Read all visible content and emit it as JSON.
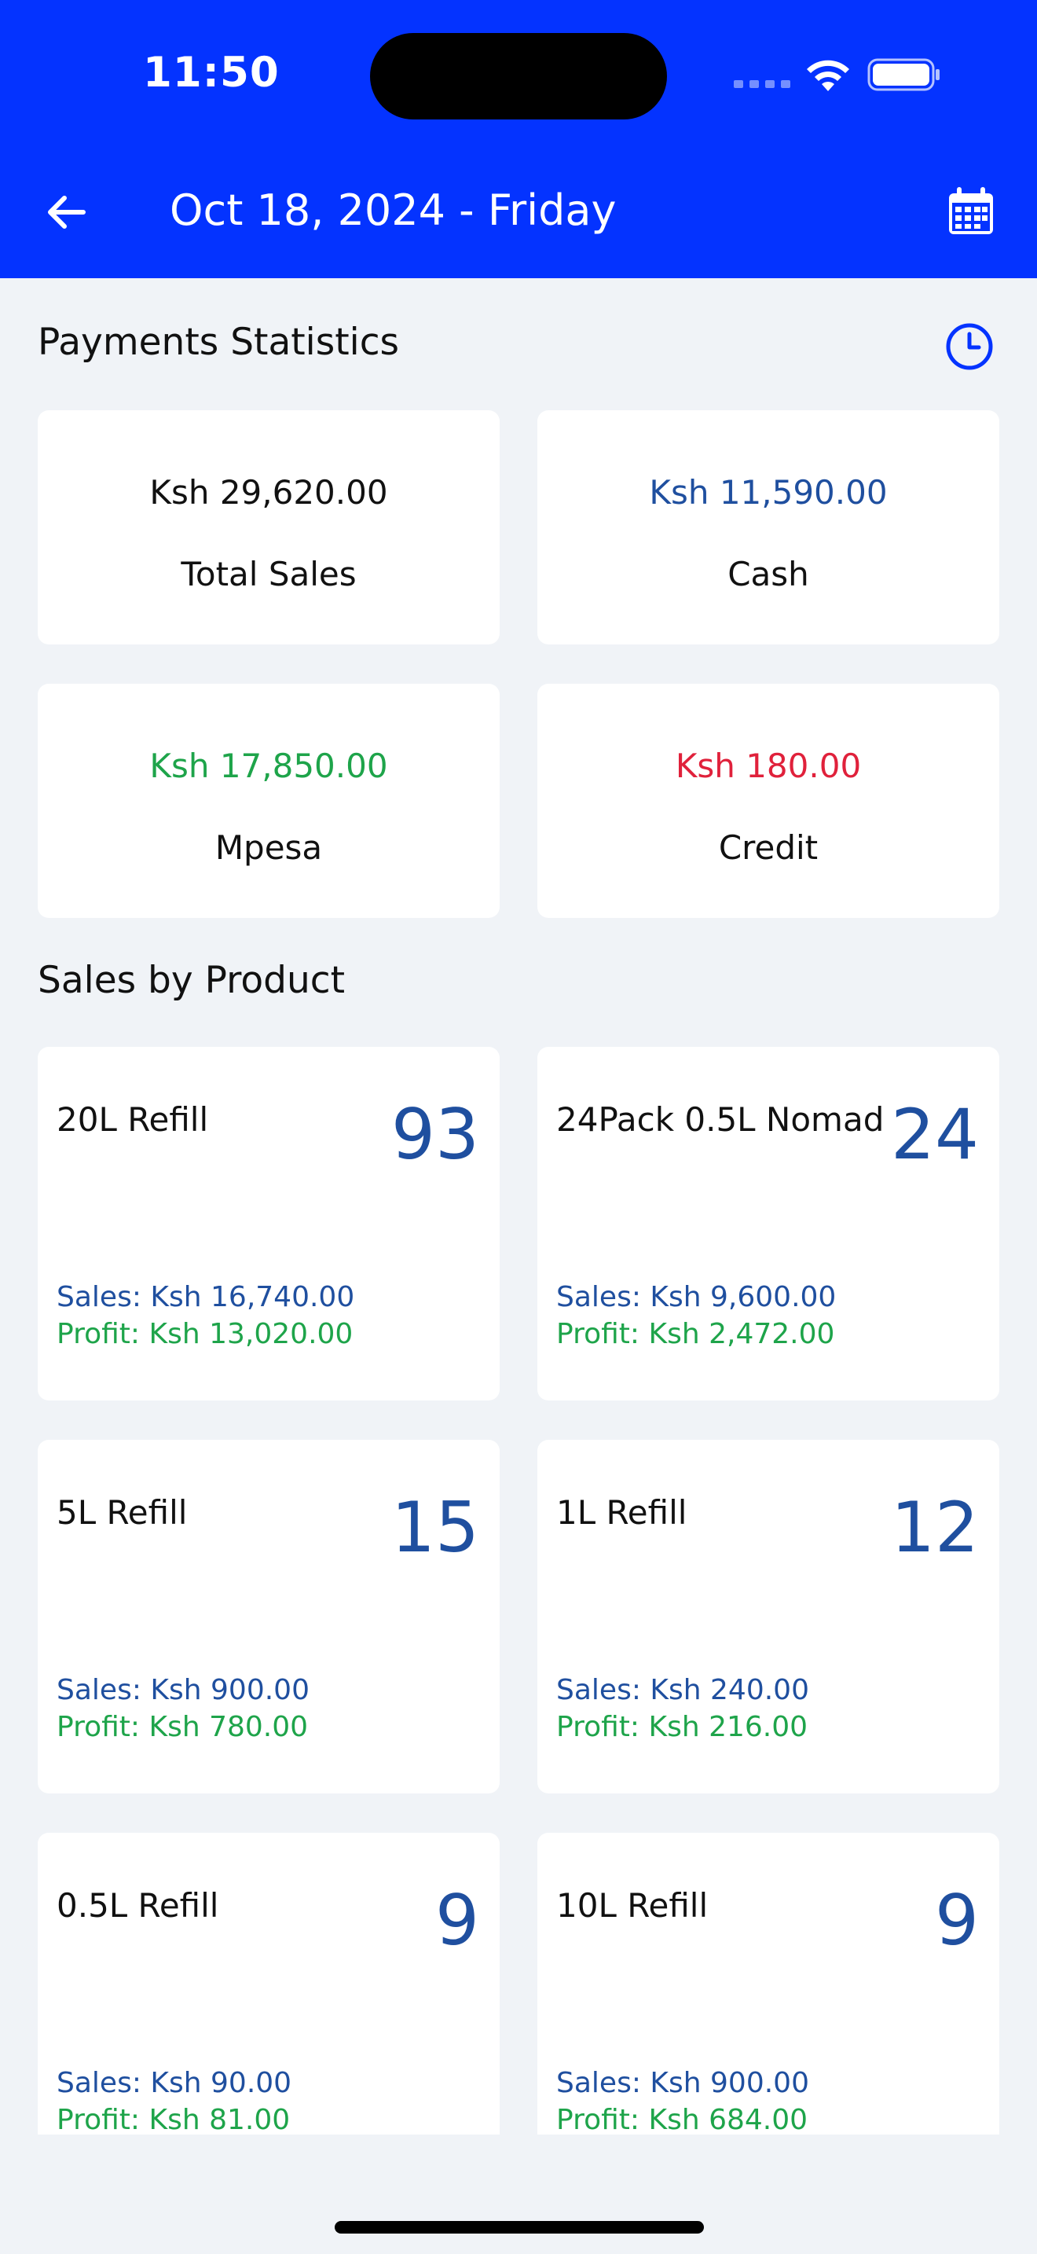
{
  "status_bar": {
    "time": "11:50"
  },
  "header": {
    "title": "Oct 18, 2024 - Friday",
    "back_icon": "arrow-left-icon",
    "calendar_icon": "calendar-icon"
  },
  "payments": {
    "title": "Payments Statistics",
    "history_icon": "clock-icon",
    "cards": [
      {
        "value": "Ksh 29,620.00",
        "label": "Total Sales",
        "color": "#111111"
      },
      {
        "value": "Ksh 11,590.00",
        "label": "Cash",
        "color": "#1f4f9f"
      },
      {
        "value": "Ksh 17,850.00",
        "label": "Mpesa",
        "color": "#1ea44a"
      },
      {
        "value": "Ksh 180.00",
        "label": "Credit",
        "color": "#e0213b"
      }
    ]
  },
  "products": {
    "title": "Sales by Product",
    "items": [
      {
        "name": "20L Refill",
        "count": "93",
        "sales": "Sales: Ksh 16,740.00",
        "profit": "Profit: Ksh 13,020.00"
      },
      {
        "name": "24Pack 0.5L Nomad",
        "count": "24",
        "sales": "Sales: Ksh 9,600.00",
        "profit": "Profit: Ksh 2,472.00"
      },
      {
        "name": "5L Refill",
        "count": "15",
        "sales": "Sales: Ksh 900.00",
        "profit": "Profit: Ksh 780.00"
      },
      {
        "name": "1L Refill",
        "count": "12",
        "sales": "Sales: Ksh 240.00",
        "profit": "Profit: Ksh 216.00"
      },
      {
        "name": "0.5L Refill",
        "count": "9",
        "sales": "Sales: Ksh 90.00",
        "profit": "Profit: Ksh 81.00"
      },
      {
        "name": "10L Refill",
        "count": "9",
        "sales": "Sales: Ksh 900.00",
        "profit": "Profit: Ksh 684.00"
      }
    ]
  },
  "colors": {
    "header_bg": "#0433ff",
    "page_bg": "#f0f3f7",
    "accent_blue": "#1f4f9f",
    "profit_green": "#1ea44a"
  }
}
